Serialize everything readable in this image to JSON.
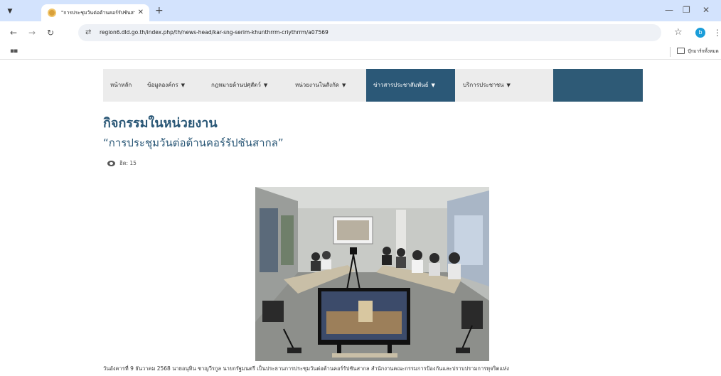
{
  "browser": {
    "tab_title": "\"การประชุมวันต่อต้านคอร์รัปชันสากล\"",
    "url": "region6.dld.go.th/index.php/th/news-head/kar-sng-serim-khunthrrm-criythrrm/a07569",
    "bookmark_folder": "บุ๊กมาร์กทั้งหมด",
    "profile_initial": "b"
  },
  "nav": {
    "items": [
      {
        "label": "หน้าหลัก",
        "has_dropdown": false
      },
      {
        "label": "ข้อมูลองค์กร",
        "has_dropdown": true
      },
      {
        "label": "กฎหมายด้านปศุสัตว์",
        "has_dropdown": true
      },
      {
        "label": "หน่วยงานในสังกัด",
        "has_dropdown": true
      },
      {
        "label": "ข่าวสารประชาสัมพันธ์",
        "has_dropdown": true,
        "active": true
      },
      {
        "label": "บริการประชาชน",
        "has_dropdown": true
      }
    ]
  },
  "article": {
    "section_title": "กิจกรรมในหน่วยงาน",
    "headline": "“การประชุมวันต่อต้านคอร์รัปชันสากล”",
    "views": "ฮิต: 15",
    "caption": "วันอังคารที่ 9 ธันวาคม 2568 นายอนุทิน ชาญวีรกูล นายกรัฐมนตรี เป็นประธานการประชุมวันต่อต้านคอร์รัปชันสากล สำนักงานคณะกรรมการป้องกันและปราบปรามการทุจริตแห่ง"
  },
  "colors": {
    "nav_active": "#2b5877",
    "title": "#2b5877",
    "tab_bar": "#d3e3fd"
  }
}
